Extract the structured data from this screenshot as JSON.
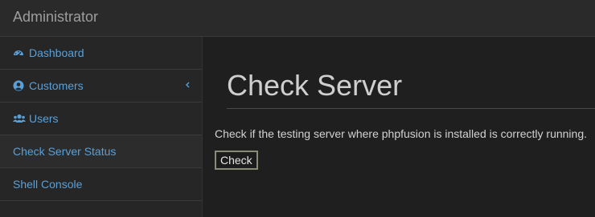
{
  "navbar": {
    "brand": "Administrator"
  },
  "sidebar": {
    "items": [
      {
        "label": "Dashboard",
        "icon": "dashboard-icon"
      },
      {
        "label": "Customers",
        "icon": "user-circle-icon",
        "has_caret": true
      },
      {
        "label": "Users",
        "icon": "users-icon"
      },
      {
        "label": "Check Server Status",
        "active": true
      },
      {
        "label": "Shell Console"
      }
    ]
  },
  "main": {
    "title": "Check Server",
    "description": "Check if the testing server where phpfusion is installed is correctly running.",
    "check_button": "Check"
  },
  "colors": {
    "link": "#5aa0d8",
    "background": "#222222",
    "content_background": "#1f1f1f",
    "title": "#cfcfcf"
  }
}
